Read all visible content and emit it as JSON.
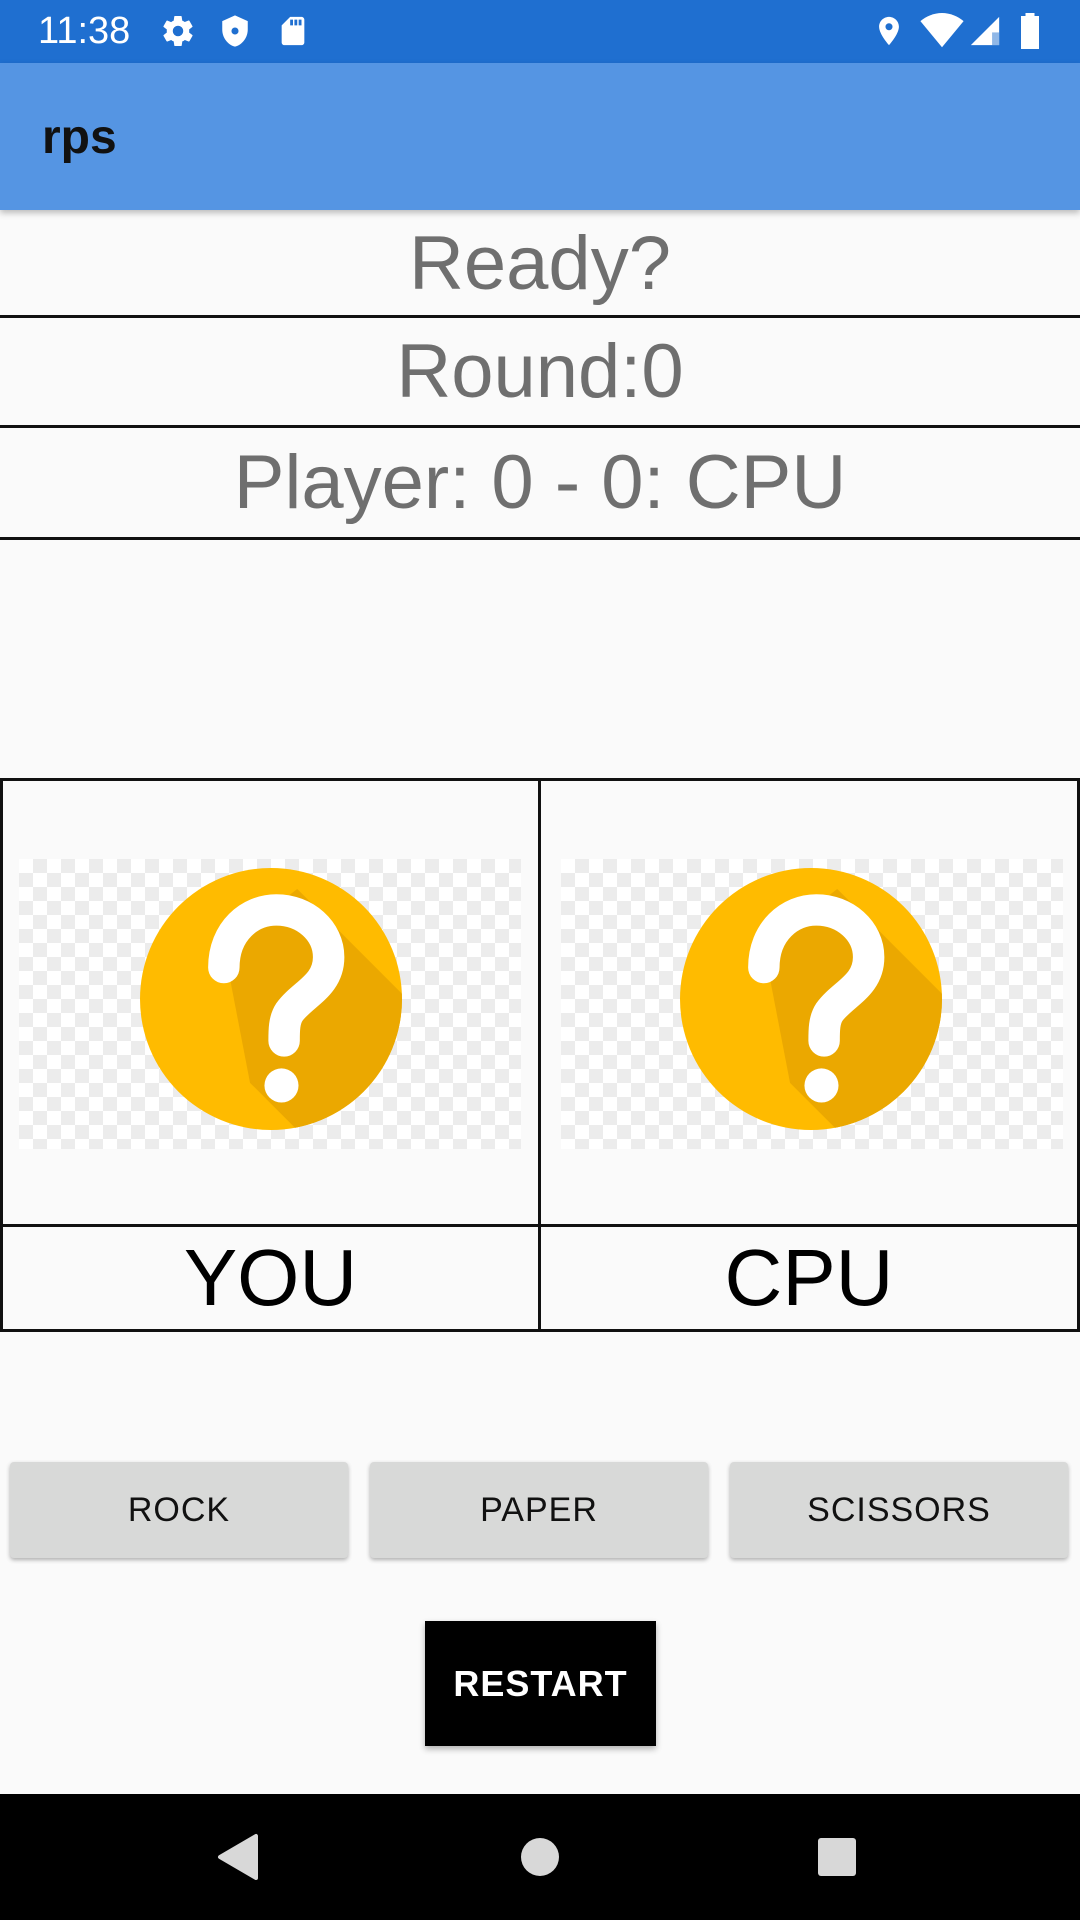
{
  "status_bar": {
    "time": "11:38",
    "icons_left": [
      "settings-gear-icon",
      "shield-icon",
      "sd-card-icon"
    ],
    "icons_right": [
      "location-icon",
      "wifi-icon",
      "signal-icon",
      "battery-icon"
    ]
  },
  "app_bar": {
    "title": "rps"
  },
  "info": {
    "status": "Ready?",
    "round": "Round:0",
    "score": "Player: 0 - 0: CPU"
  },
  "board": {
    "player_label": "YOU",
    "cpu_label": "CPU",
    "player_icon": "question-mark-icon",
    "cpu_icon": "question-mark-icon"
  },
  "buttons": {
    "rock": "ROCK",
    "paper": "PAPER",
    "scissors": "SCISSORS",
    "restart": "RESTART"
  },
  "colors": {
    "status_bar": "#1f6fd0",
    "app_bar": "#5595e3",
    "question_circle": "#ffbb00",
    "question_shadow": "#eba800"
  },
  "nav_bar": [
    "back-icon",
    "home-icon",
    "recents-icon"
  ]
}
